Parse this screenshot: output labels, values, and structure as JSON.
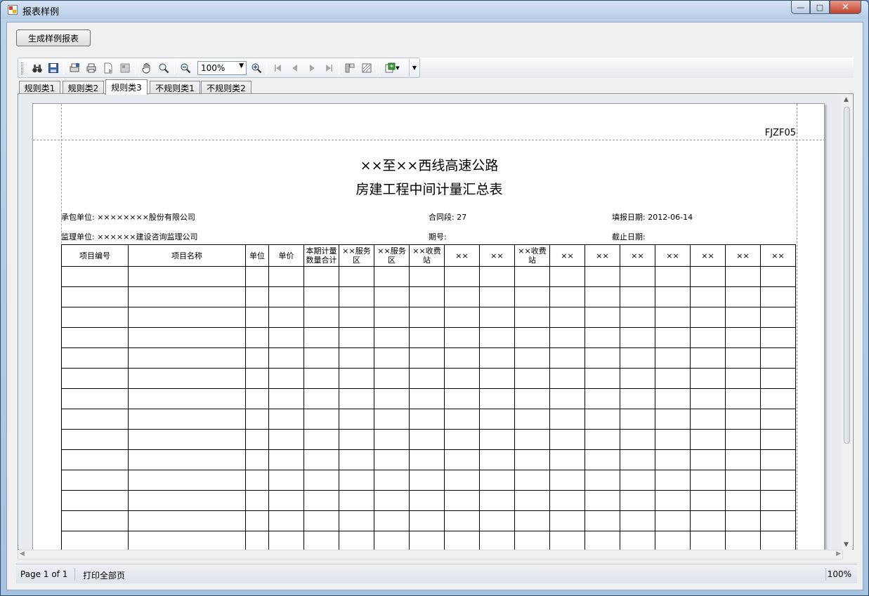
{
  "window": {
    "title": "报表样例"
  },
  "generate_button": "生成样例报表",
  "toolbar": {
    "zoom": "100%"
  },
  "tabs": [
    "规则类1",
    "规则类2",
    "规则类3",
    "不规则类1",
    "不规则类2"
  ],
  "report": {
    "code": "FJZF05",
    "title1": "××至××西线高速公路",
    "title2": "房建工程中间计量汇总表",
    "contractor": "承包单位: ××××××××股份有限公司",
    "contract": "合同段: 27",
    "report_date": "填报日期: 2012-06-14",
    "supervisor": "监理单位: ××××××建设咨询监理公司",
    "period": "期号:",
    "cutoff": "截止日期:",
    "columns": [
      "项目编号",
      "项目名称",
      "单位",
      "单价",
      "本期计量数量合计",
      "××服务区",
      "××服务区",
      "××收费站",
      "××",
      "××",
      "××收费站",
      "××",
      "××",
      "××",
      "××",
      "××",
      "××",
      "××"
    ]
  },
  "status": {
    "page": "Page 1 of 1",
    "print": "打印全部页",
    "zoom": "100%"
  }
}
